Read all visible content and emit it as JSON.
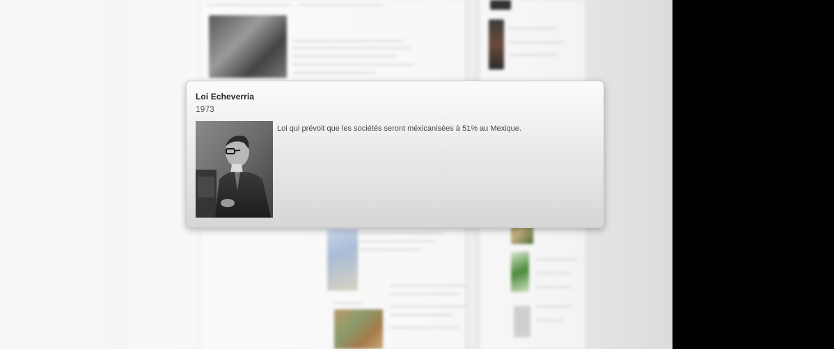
{
  "popover": {
    "title": "Loi Echeverria",
    "year": "1973",
    "description": "Loi qui prévoit que les sociétés seront méxicanisées à 51% au Mexique.",
    "photo_icon": "portrait-photo-icon"
  },
  "colors": {
    "card_top": "#fbfbfb",
    "card_bottom": "#d6d6d6",
    "background": "#f3f3f3",
    "right_panel": "#000000"
  }
}
